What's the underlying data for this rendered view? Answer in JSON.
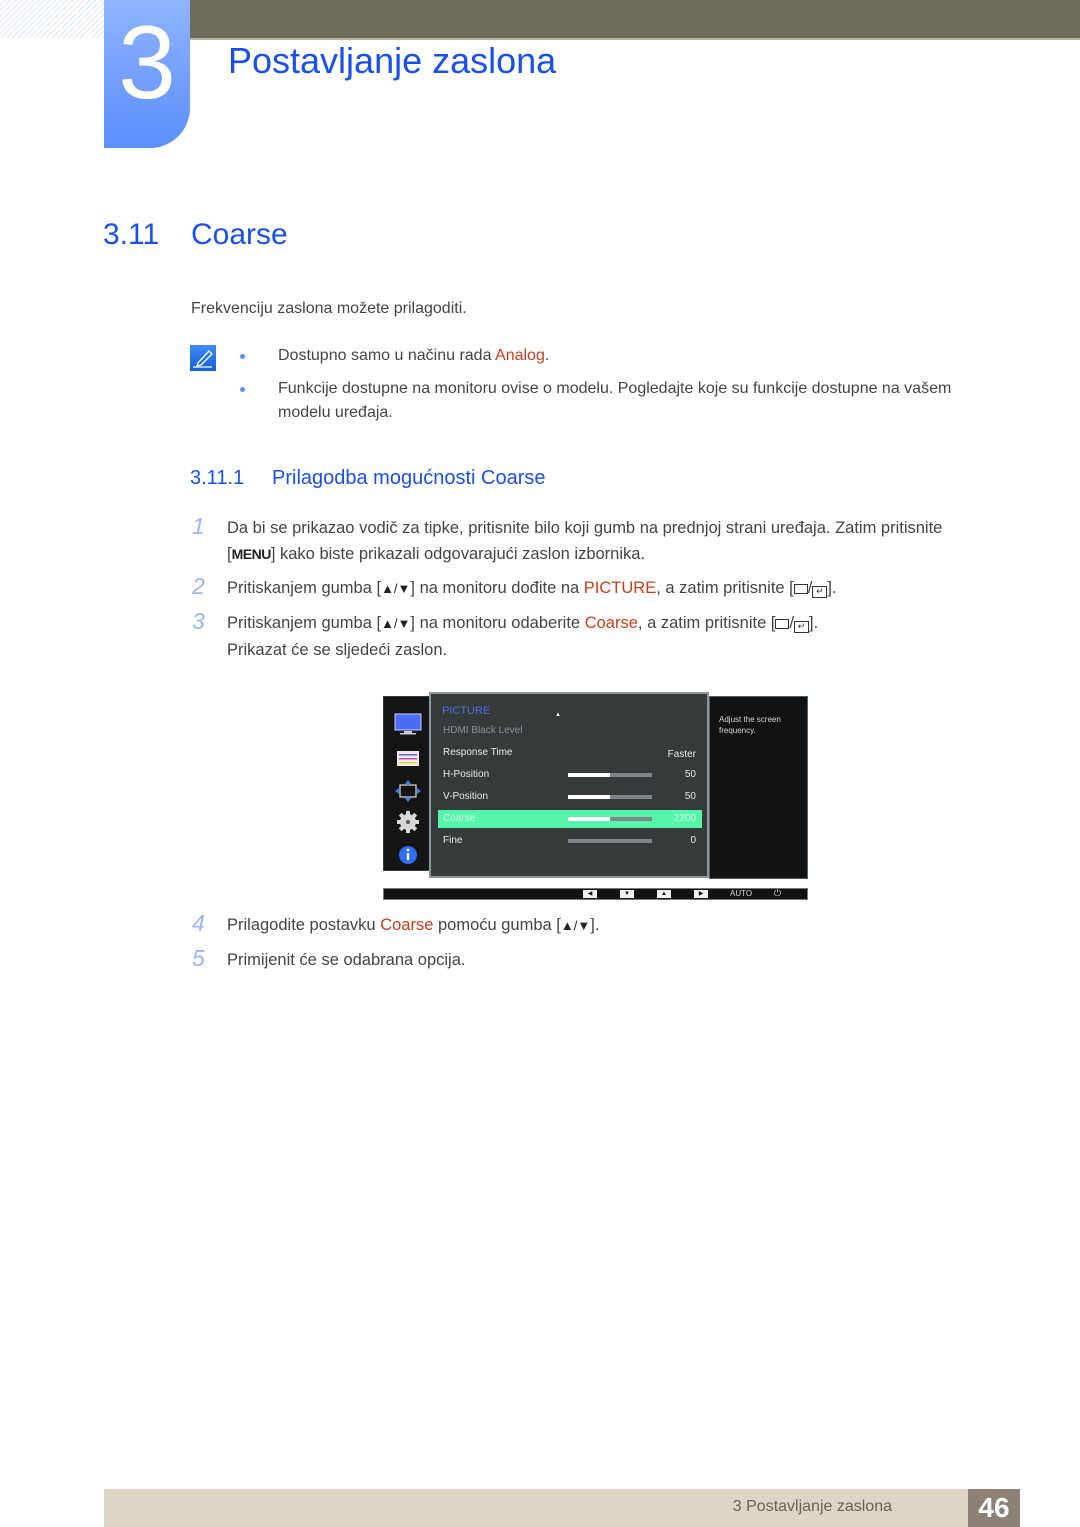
{
  "chapter": {
    "number": "3",
    "title": "Postavljanje zaslona"
  },
  "section": {
    "number": "3.11",
    "title": "Coarse",
    "intro": "Frekvenciju zaslona možete prilagoditi."
  },
  "notes": {
    "icon": "note-pencil-icon",
    "items": [
      {
        "pre": "Dostupno samo u načinu rada ",
        "highlight": "Analog",
        "post": "."
      },
      {
        "pre": "Funkcije dostupne na monitoru ovise o modelu. Pogledajte koje su funkcije dostupne na vašem modelu uređaja.",
        "highlight": "",
        "post": ""
      }
    ]
  },
  "subsection": {
    "number": "3.11.1",
    "title": "Prilagodba mogućnosti Coarse"
  },
  "steps": [
    {
      "num": "1",
      "line1": "Da bi se prikazao vodič za tipke, pritisnite bilo koji gumb na prednjoj strani uređaja. Zatim pritisnite",
      "key": "MENU",
      "line2": " kako biste prikazali odgovarajući zaslon izbornika."
    },
    {
      "num": "2",
      "pre": "Pritiskanjem gumba [",
      "arrows": "▲/▼",
      "mid": "] na monitoru dođite na ",
      "highlight": "PICTURE",
      "post": ", a zatim pritisnite ["
    },
    {
      "num": "3",
      "pre": "Pritiskanjem gumba [",
      "arrows": "▲/▼",
      "mid": "] na monitoru odaberite ",
      "highlight": "Coarse",
      "post": ", a zatim pritisnite [",
      "extra": "Prikazat će se sljedeći zaslon."
    },
    {
      "num": "4",
      "pre": "Prilagodite postavku ",
      "highlight": "Coarse",
      "mid": " pomoću gumba [",
      "arrows": "▲/▼",
      "post": "]."
    },
    {
      "num": "5",
      "text": "Primijenit će se odabrana opcija."
    }
  ],
  "osd": {
    "menu_title": "PICTURE",
    "help_text": "Adjust the screen frequency.",
    "sidebar_icons": [
      "monitor-icon",
      "color-settings-icon",
      "size-position-icon",
      "gear-icon",
      "info-icon"
    ],
    "rows": [
      {
        "label": "HDMI Black Level",
        "value": "",
        "state": "disabled",
        "bar": null
      },
      {
        "label": "Response Time",
        "value": "Faster",
        "state": "normal",
        "bar": null
      },
      {
        "label": "H-Position",
        "value": "50",
        "state": "normal",
        "bar": 0.5
      },
      {
        "label": "V-Position",
        "value": "50",
        "state": "normal",
        "bar": 0.5
      },
      {
        "label": "Coarse",
        "value": "2200",
        "state": "selected",
        "bar": 0.5
      },
      {
        "label": "Fine",
        "value": "0",
        "state": "normal",
        "bar": 0
      }
    ],
    "buttons": {
      "left": "◀",
      "down": "▼",
      "up": "▲",
      "right": "▶",
      "auto": "AUTO",
      "power": "⏻"
    },
    "scroll_up_arrow": "▲",
    "colors": {
      "highlight_row": "#57f5a9",
      "menu_title": "#4d6fde"
    }
  },
  "footer": {
    "text": "3 Postavljanje zaslona",
    "page": "46"
  },
  "colors": {
    "accent_blue": "#1a4ff0",
    "highlight_red": "#c6401b"
  }
}
